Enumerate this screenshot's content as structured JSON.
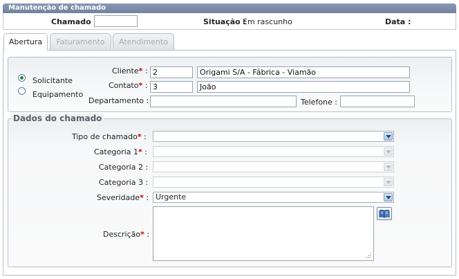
{
  "header": {
    "title": "Manutenção de chamado"
  },
  "info": {
    "chamado_label": "Chamado :",
    "chamado_value": "",
    "situacao_label": "Situação :",
    "situacao_value": "Em rascunho",
    "data_label": "Data :"
  },
  "tabs": [
    {
      "label": "Abertura",
      "active": true
    },
    {
      "label": "Faturamento",
      "active": false
    },
    {
      "label": "Atendimento",
      "active": false
    }
  ],
  "requester": {
    "options": [
      {
        "label": "Solicitante",
        "selected": true
      },
      {
        "label": "Equipamento",
        "selected": false
      }
    ],
    "cliente_label": "Cliente",
    "cliente_code": "2",
    "cliente_name": "Origami S/A - Fábrica - Viamão",
    "contato_label": "Contato",
    "contato_code": "3",
    "contato_name": "João",
    "departamento_label": "Departamento :",
    "departamento_value": "",
    "telefone_label": "Telefone :",
    "telefone_value": ""
  },
  "dados": {
    "legend": "Dados do chamado",
    "tipo_label": "Tipo de chamado",
    "tipo_value": "",
    "cat1_label": "Categoria 1",
    "cat1_value": "",
    "cat2_label": "Categoria 2 :",
    "cat2_value": "",
    "cat3_label": "Categoria 3 :",
    "cat3_value": "",
    "severidade_label": "Severidade",
    "severidade_value": "Urgente",
    "descricao_label": "Descrição",
    "descricao_value": ""
  },
  "marks": {
    "required": "*",
    "colon": ":"
  },
  "icons": {
    "dictionary": "book-icon"
  }
}
